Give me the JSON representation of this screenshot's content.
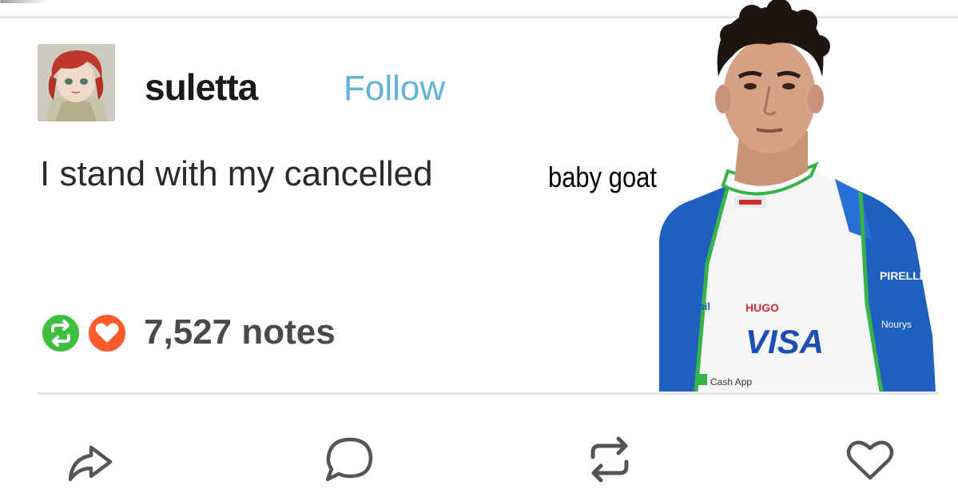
{
  "post": {
    "username": "suletta",
    "follow_label": "Follow",
    "body_text": "I stand with my cancelled",
    "overlay_caption": "baby goat",
    "notes": "7,527 notes"
  },
  "icons": {
    "reblog_badge": "reblog-icon",
    "like_badge": "heart-icon",
    "share": "share-icon",
    "reply": "reply-icon",
    "reblog": "reblog-icon",
    "like": "heart-icon"
  },
  "colors": {
    "follow": "#5fb3d8",
    "reblog_green": "#3fbf3f",
    "like_orange": "#ff5a2c",
    "icon_gray": "#555555"
  }
}
